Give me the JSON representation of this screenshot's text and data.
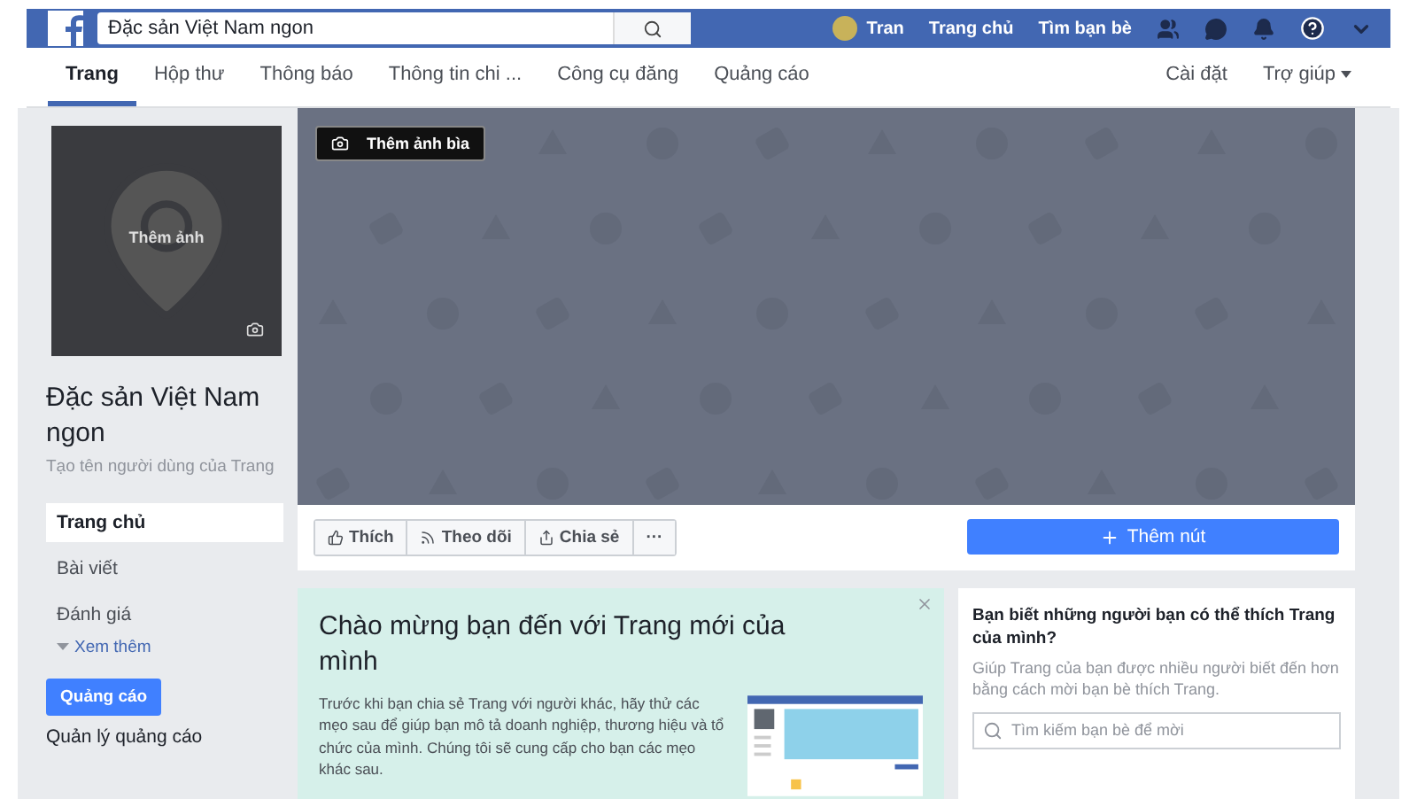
{
  "topbar": {
    "search": {
      "value": "Đặc sản Việt Nam ngon"
    },
    "user": "Tran",
    "links": [
      "Trang chủ",
      "Tìm bạn bè"
    ]
  },
  "tabs": [
    {
      "label": "Trang",
      "selected": true
    },
    {
      "label": "Hộp thư",
      "selected": false
    },
    {
      "label": "Thông báo",
      "selected": false
    },
    {
      "label": "Thông tin chi ...",
      "selected": false
    },
    {
      "label": "Công cụ đăng",
      "selected": false
    },
    {
      "label": "Quảng cáo",
      "selected": false
    }
  ],
  "tabs_right": [
    {
      "label": "Cài đặt",
      "dropdown": false
    },
    {
      "label": "Trợ giúp",
      "dropdown": true
    }
  ],
  "profile": {
    "photo_label": "Thêm ảnh",
    "name": "Đặc sản Việt Nam ngon",
    "username_hint": "Tạo tên người dùng của Trang"
  },
  "sidebar": {
    "items": [
      {
        "label": "Trang chủ",
        "selected": true
      },
      {
        "label": "Bài viết",
        "selected": false
      },
      {
        "label": "Đánh giá",
        "selected": false
      }
    ],
    "more": "Xem thêm",
    "ad_button": "Quảng cáo",
    "ad_manage": "Quản lý quảng cáo"
  },
  "cover": {
    "button": "Thêm ảnh bìa"
  },
  "actions": [
    {
      "kind": "like",
      "label": "Thích"
    },
    {
      "kind": "follow",
      "label": "Theo dõi"
    },
    {
      "kind": "share",
      "label": "Chia sẻ"
    },
    {
      "kind": "more",
      "label": "···"
    }
  ],
  "add_button": "Thêm nút",
  "welcome": {
    "title": "Chào mừng bạn đến với Trang mới của mình",
    "body": "Trước khi bạn chia sẻ Trang với người khác, hãy thử các mẹo sau để giúp bạn mô tả doanh nghiệp, thương hiệu và tổ chức của mình. Chúng tôi sẽ cung cấp cho bạn các mẹo khác sau."
  },
  "invite": {
    "title": "Bạn biết những người bạn có thể thích Trang của mình?",
    "body": "Giúp Trang của bạn được nhiều người biết đến hơn bằng cách mời bạn bè thích Trang.",
    "search": {
      "placeholder": "Tìm kiếm bạn bè để mời"
    }
  }
}
